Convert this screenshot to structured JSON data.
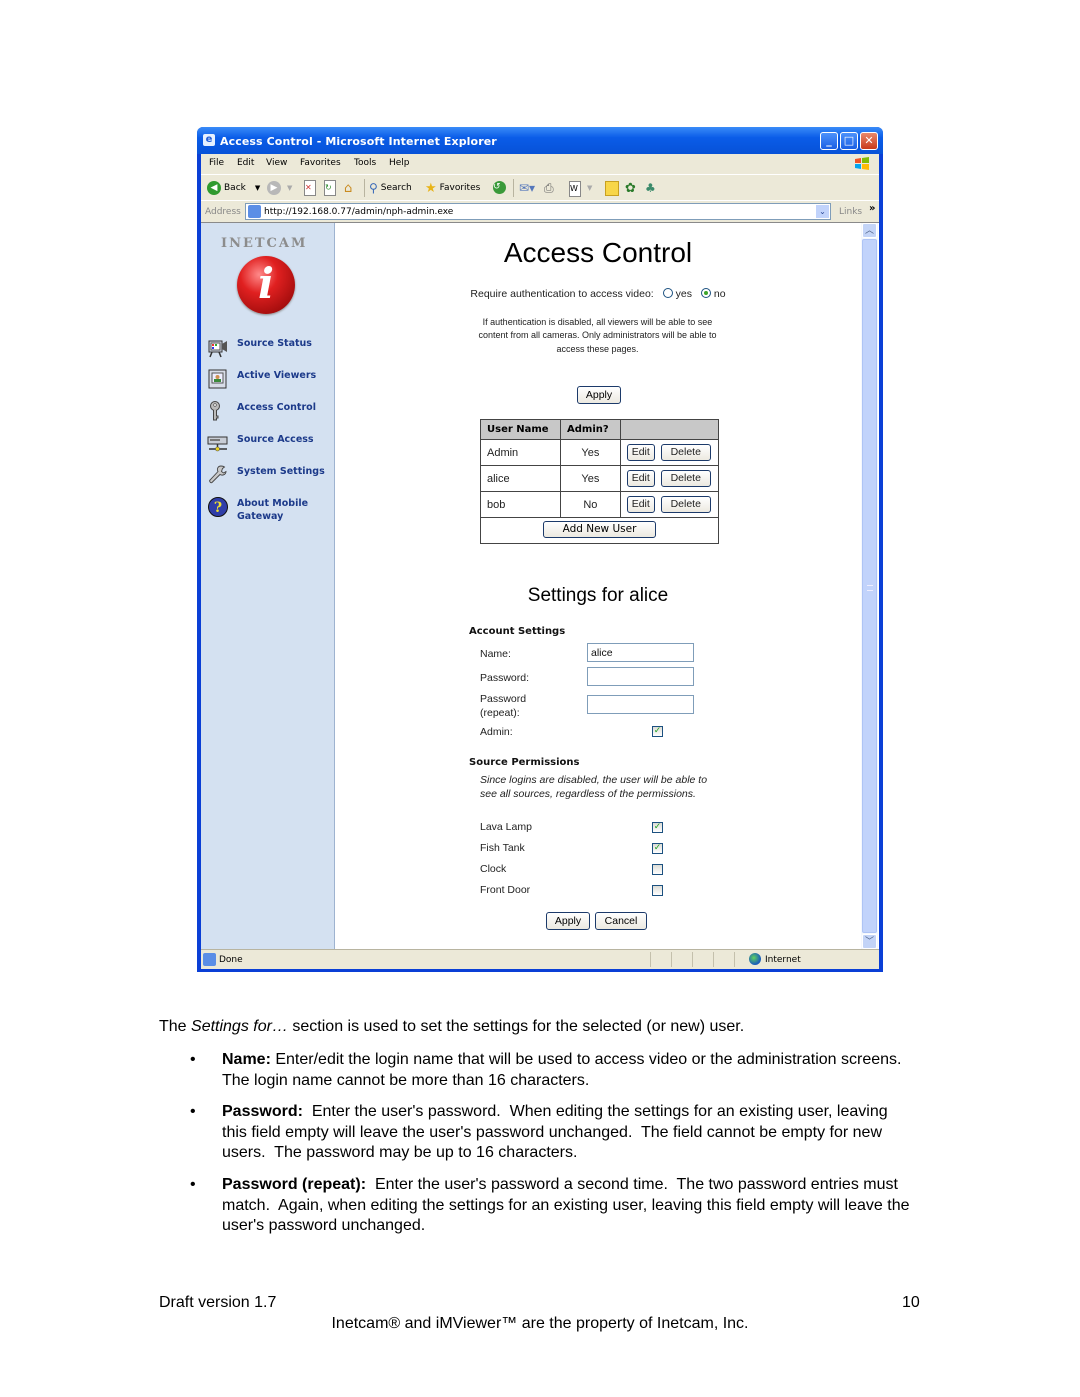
{
  "browser": {
    "window_title": "Access Control - Microsoft Internet Explorer",
    "menu": [
      "File",
      "Edit",
      "View",
      "Favorites",
      "Tools",
      "Help"
    ],
    "toolbar": {
      "back_label": "Back",
      "search_label": "Search",
      "favorites_label": "Favorites"
    },
    "address": {
      "label": "Address",
      "url": "http://192.168.0.77/admin/nph-admin.exe",
      "links_label": "Links",
      "more_glyph": "»"
    },
    "status": {
      "text": "Done",
      "zone": "Internet"
    }
  },
  "sidebar": {
    "brand": "INETCAM",
    "logo_glyph": "i",
    "items": [
      {
        "label": "Source Status",
        "icon": "camera-icon"
      },
      {
        "label": "Active Viewers",
        "icon": "viewer-icon"
      },
      {
        "label": "Access Control",
        "icon": "key-icon"
      },
      {
        "label": "Source Access",
        "icon": "network-icon"
      },
      {
        "label": "System Settings",
        "icon": "wrench-icon"
      },
      {
        "label": "About Mobile Gateway",
        "icon": "help-icon"
      }
    ]
  },
  "access": {
    "title": "Access Control",
    "auth_question": "Require authentication to access video:",
    "auth_options": [
      {
        "label": "yes",
        "selected": false
      },
      {
        "label": "no",
        "selected": true
      }
    ],
    "note": "If authentication is disabled, all viewers will be able to see content from all cameras. Only administrators will be able to access these pages.",
    "apply_label": "Apply"
  },
  "users_table": {
    "columns": [
      "User Name",
      "Admin?",
      ""
    ],
    "rows": [
      {
        "name": "Admin",
        "admin": "Yes"
      },
      {
        "name": "alice",
        "admin": "Yes"
      },
      {
        "name": "bob",
        "admin": "No"
      }
    ],
    "edit_label": "Edit",
    "delete_label": "Delete",
    "add_label": "Add New User"
  },
  "settings": {
    "title": "Settings for alice",
    "account_heading": "Account Settings",
    "name_label": "Name:",
    "name_value": "alice",
    "password_label": "Password:",
    "password_value": "",
    "password_repeat_label": "Password (repeat):",
    "password_repeat_value": "",
    "admin_label": "Admin:",
    "admin_checked": true,
    "permissions_heading": "Source Permissions",
    "permissions_note": "Since logins are disabled, the user will be able to see all sources, regardless of the permissions.",
    "sources": [
      {
        "name": "Lava Lamp",
        "checked": true
      },
      {
        "name": "Fish Tank",
        "checked": true
      },
      {
        "name": "Clock",
        "checked": false
      },
      {
        "name": "Front Door",
        "checked": false
      }
    ],
    "apply_label": "Apply",
    "cancel_label": "Cancel"
  },
  "document": {
    "intro_pre": "The ",
    "intro_em": "Settings for…",
    "intro_post": " section is used to set the settings for the selected (or new) user.",
    "bullets": [
      {
        "term": "Name:",
        "text": " Enter/edit the login name that will be used to access video or the administration screens.  The login name cannot be more than 16 characters."
      },
      {
        "term": "Password:",
        "text": "  Enter the user's password.  When editing the settings for an existing user, leaving this field empty will leave the user's password unchanged.  The field cannot be empty for new users.  The password may be up to 16 characters."
      },
      {
        "term": "Password (repeat):",
        "text": "  Enter the user's password a second time.  The two password entries must match.  Again, when editing the settings for an existing user, leaving this field empty will leave the user's password unchanged."
      }
    ],
    "bullet_glyph": "•",
    "footer_left": "Draft version 1.7",
    "page_number": "10",
    "footer_center": "Inetcam® and iMViewer™ are the property of Inetcam, Inc."
  }
}
